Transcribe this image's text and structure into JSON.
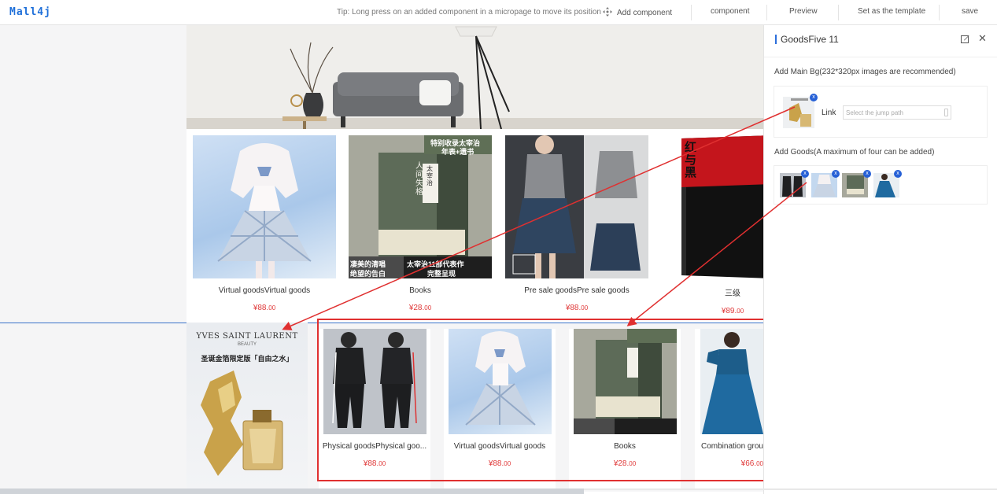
{
  "topbar": {
    "logo": "Mall4j",
    "tip": "Tip: Long press on an added component in a micropage to move its position",
    "add_component": "Add component",
    "component": "component",
    "preview": "Preview",
    "set_template": "Set as the template",
    "save": "save"
  },
  "row1": [
    {
      "name": "Virtual goodsVirtual goods",
      "currency": "¥",
      "price_int": "88.",
      "price_dec": "00"
    },
    {
      "name": "Books",
      "currency": "¥",
      "price_int": "28.",
      "price_dec": "00"
    },
    {
      "name": "Pre sale goodsPre sale goods",
      "currency": "¥",
      "price_int": "88.",
      "price_dec": "00"
    },
    {
      "name": "三级",
      "currency": "¥",
      "price_int": "89.",
      "price_dec": "00"
    }
  ],
  "main_bg": {
    "brand": "YVES SAINT LAURENT",
    "brand_sub": "BEAUTY",
    "headline": "圣诞金箔限定版「自由之水」"
  },
  "row2": [
    {
      "name": "Physical goodsPhysical goo...",
      "currency": "¥",
      "price_int": "88.",
      "price_dec": "00"
    },
    {
      "name": "Virtual goodsVirtual goods",
      "currency": "¥",
      "price_int": "88.",
      "price_dec": "00"
    },
    {
      "name": "Books",
      "currency": "¥",
      "price_int": "28.",
      "price_dec": "00"
    },
    {
      "name": "Combination grou",
      "currency": "¥",
      "price_int": "66.",
      "price_dec": "00"
    }
  ],
  "book_cover": {
    "banner1": "特别收录太宰治",
    "banner2": "年表+遗书",
    "title": "人间失格",
    "author": "太宰治",
    "line1": "凄美的清唱",
    "line2": "绝望的告白",
    "line3": "太宰治11部代表作",
    "line4": "完整呈现"
  },
  "red_book": {
    "title": "红与黑"
  },
  "panel": {
    "title": "GoodsFive 11",
    "main_bg_label": "Add Main Bg(232*320px images are recommended)",
    "link_label": "Link",
    "jump_placeholder": "Select the jump path",
    "goods_label": "Add Goods(A maximum of four can be added)",
    "remove_glyph": "x",
    "close_glyph": "✕"
  },
  "colors": {
    "accent": "#2660d6",
    "price": "#e03a3a",
    "highlight": "#e03030"
  }
}
